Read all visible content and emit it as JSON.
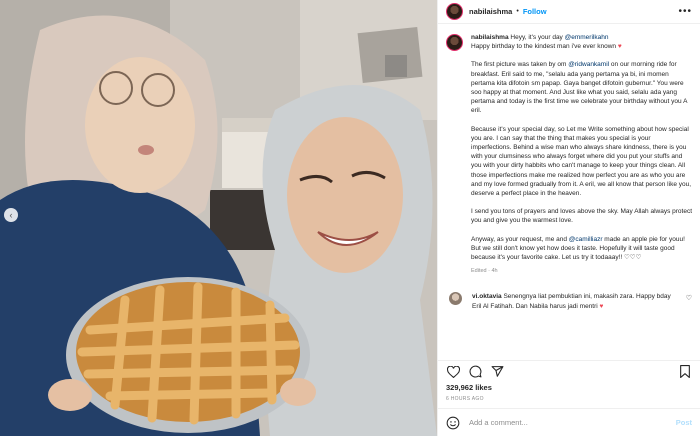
{
  "header": {
    "username": "nabilaishma",
    "separator": "•",
    "follow_label": "Follow",
    "more_label": "•••"
  },
  "caption": {
    "username": "nabilaishma",
    "p1_intro": "Heyy, it's your day ",
    "p1_mention": "@emmerilkahn",
    "p1_rest": "Happy birthday to the kindest man i've ever known ",
    "p2_a": "The first picture was taken by om ",
    "p2_mention": "@ridwankamil",
    "p2_b": " on our morning ride for breakfast. Eril said to me, \"selalu ada yang pertama ya bi, ini momen pertama kita difotoin sm papap. Gaya banget difotoin gubernur.\" You were soo happy at that moment. And Just like what you said, selalu ada yang pertama and today is the first time we celebrate your birthday without you A eril.",
    "p3": "Because it's your special day, so Let me Write something about how special you are. I can say that the thing that makes you special is your imperfections. Behind a wise man who always share kindness, there is you with your clumsiness who always forget where did you put your stuffs and you with your dirty habbits who can't manage to keep your things clean. All those imperfections make me realized how perfect you are as who you are and my love formed gradually from it. A eril, we all know that person like you, deserve a perfect place in the heaven.",
    "p4": "I send you tons of prayers and loves above the sky. May Allah always protect you and give you the warmest love.",
    "p5_a": "Anyway, as your request, me and ",
    "p5_mention": "@camilliazr",
    "p5_b": " made an apple pie for youu! But we still don't know yet how does it taste. Hopefully it will taste good because it's your favorite cake. Let us try it todaaay!! ♡♡♡",
    "meta": "Edited · 4h"
  },
  "comment": {
    "username": "vi.oktavia",
    "text": " Senengnya liat pembuktian ini, makasih zara. Happy bday Eril Al Fatihah. Dan Nabila harus jadi mentri "
  },
  "likes": "329,962 likes",
  "timestamp": "6 HOURS AGO",
  "add_comment": {
    "placeholder": "Add a comment...",
    "post_label": "Post"
  },
  "icons": [
    "heart-icon",
    "comment-icon",
    "share-icon",
    "save-icon",
    "emoji-icon",
    "more-icon",
    "chevron-left-icon"
  ],
  "colors": {
    "accent": "#0095f6",
    "heart": "#ed4956",
    "muted": "#8e8e8e"
  }
}
